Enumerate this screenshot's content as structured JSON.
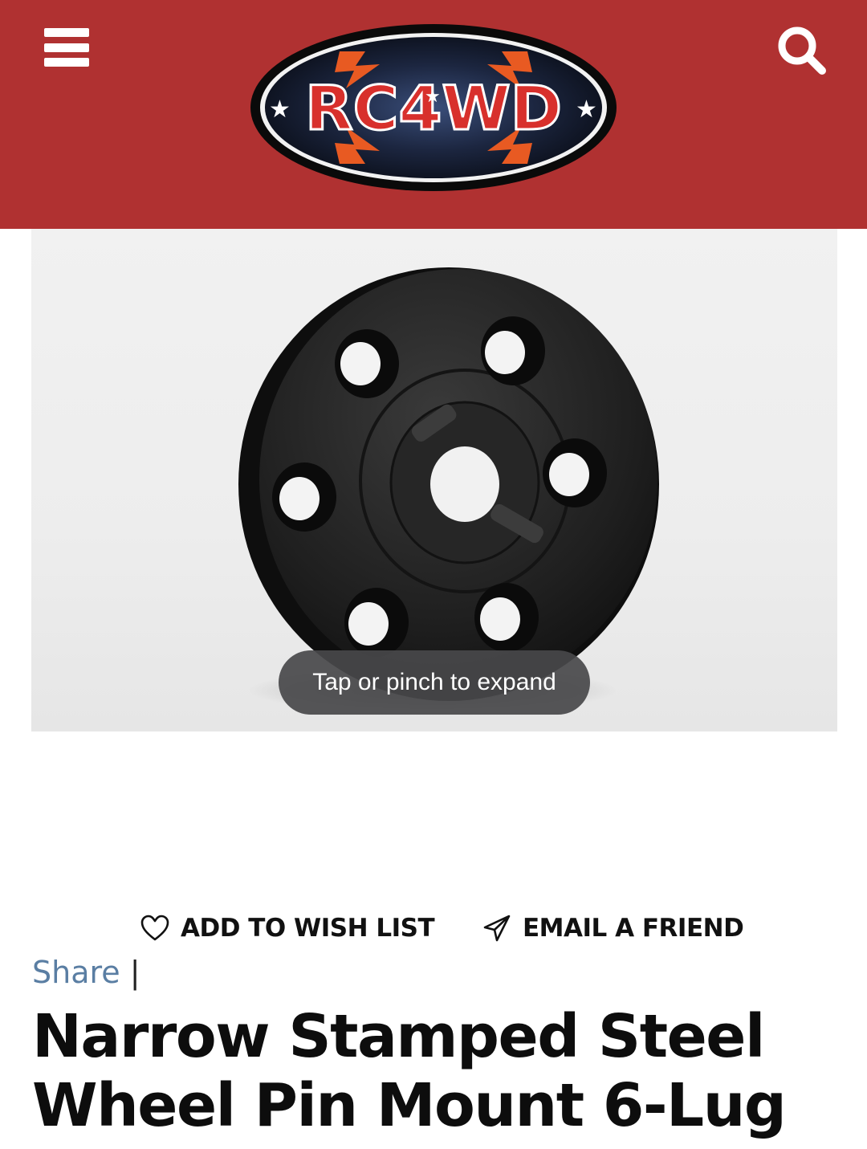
{
  "header": {
    "menu_icon": "hamburger-menu-icon",
    "search_icon": "search-icon",
    "logo_text": "RC4WD",
    "brand_color": "#b03131"
  },
  "product_image": {
    "subject": "black 6-lug wheel pin mount",
    "expand_hint": "Tap or pinch to expand"
  },
  "actions": {
    "wishlist_label": "ADD TO WISH LIST",
    "wishlist_icon": "heart-icon",
    "email_label": "EMAIL A FRIEND",
    "email_icon": "paper-plane-icon"
  },
  "share": {
    "label": "Share",
    "separator": "|",
    "link_color": "#5a7ea3"
  },
  "product": {
    "title": "Narrow Stamped Steel Wheel Pin Mount 6-Lug"
  }
}
